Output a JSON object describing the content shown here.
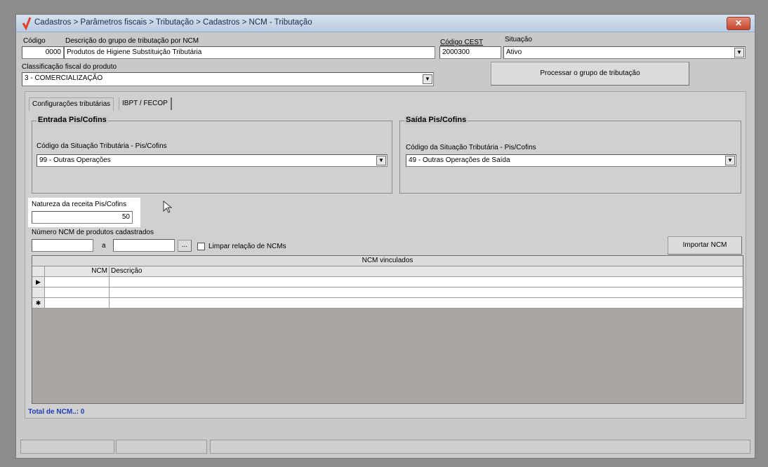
{
  "window": {
    "title": "Cadastros > Parâmetros fiscais > Tributação > Cadastros > NCM - Tributação",
    "close_label": "✕"
  },
  "header": {
    "codigo_label": "Código",
    "codigo_value": "0000",
    "descricao_label": "Descrição do grupo de tributação por NCM",
    "descricao_value": "Produtos de Higiene Substituição Tributária",
    "cest_label": "Código CEST",
    "cest_value": "2000300",
    "situacao_label": "Situação",
    "situacao_value": "Ativo",
    "classificacao_label": "Classificação fiscal do produto",
    "classificacao_value": "3 - COMERCIALIZAÇÃO",
    "processar_button": "Processar o grupo de tributação"
  },
  "tabs": [
    {
      "label": "Configurações tributárias"
    },
    {
      "label": "IBPT / FECOP"
    }
  ],
  "entrada": {
    "title": "Entrada Pis/Cofins",
    "cst_label": "Código da Situação Tributária - Pis/Cofins",
    "cst_value": "99 - Outras Operações"
  },
  "saida": {
    "title": "Saída Pis/Cofins",
    "cst_label": "Código da Situação Tributária - Pis/Cofins",
    "cst_value": "49 - Outras Operações de Saída"
  },
  "natureza": {
    "label": "Natureza da receita Pis/Cofins",
    "value": "50"
  },
  "ncm_range": {
    "label": "Número  NCM de produtos cadastrados",
    "separator": "a",
    "browse_label": "...",
    "from_value": "",
    "to_value": "",
    "limpar_label": "Limpar relação de NCMs",
    "importar_button": "Importar NCM"
  },
  "grid": {
    "title": "NCM vinculados",
    "col_ncm": "NCM",
    "col_descricao": "Descrição"
  },
  "footer": {
    "total": "Total de NCM..: 0"
  },
  "colors": {
    "accent_text": "#1f3db8",
    "app_icon": "#e0402a"
  }
}
